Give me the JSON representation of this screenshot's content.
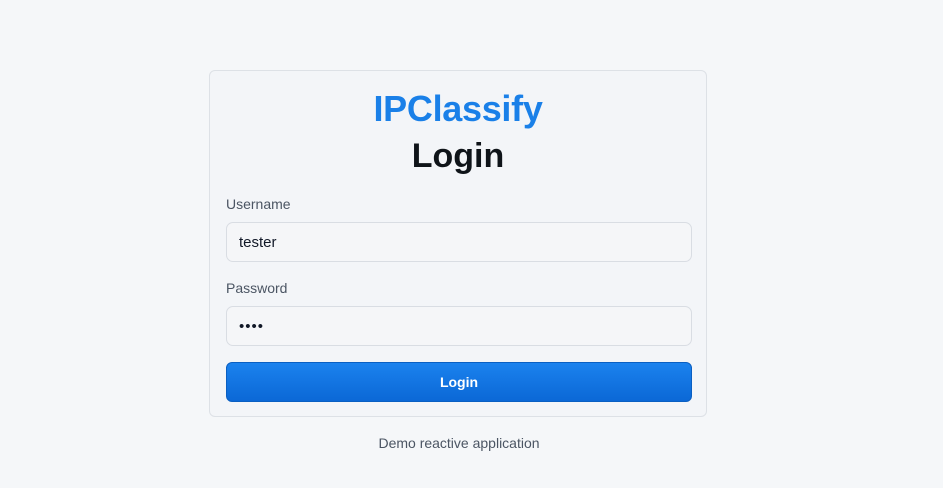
{
  "app": {
    "brand": "IPClassify",
    "title": "Login"
  },
  "form": {
    "username_label": "Username",
    "username_value": "tester",
    "password_label": "Password",
    "password_value": "demo",
    "submit_label": "Login"
  },
  "footer": {
    "text": "Demo reactive application"
  },
  "colors": {
    "brand": "#1a80e8",
    "button": "#0b68d6",
    "background": "#f5f7f9"
  }
}
